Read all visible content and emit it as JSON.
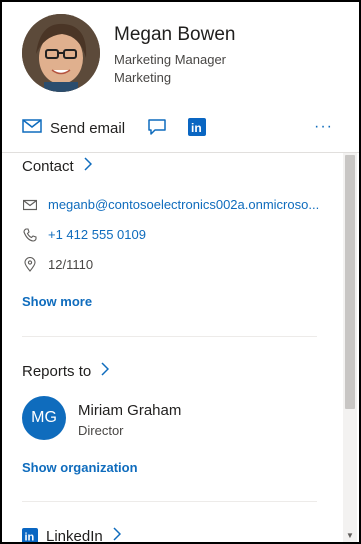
{
  "person": {
    "name": "Megan Bowen",
    "job_title": "Marketing Manager",
    "department": "Marketing"
  },
  "actions": {
    "send_email_label": "Send email",
    "more_label": "···",
    "chat_icon": "chat-icon",
    "linkedin_icon": "linkedin-icon"
  },
  "contact": {
    "title": "Contact",
    "email": "meganb@contosoelectronics002a.onmicroso...",
    "phone": "+1 412 555 0109",
    "office": "12/1110",
    "show_more": "Show more"
  },
  "reports_to": {
    "title": "Reports to",
    "initials": "MG",
    "name": "Miriam Graham",
    "job_title": "Director",
    "show_org": "Show organization"
  },
  "linkedin": {
    "title": "LinkedIn",
    "badge": "in"
  },
  "colors": {
    "accent": "#0f6cbd",
    "avatar_bg": "#0f6cbd",
    "linkedin": "#0a66c2"
  }
}
